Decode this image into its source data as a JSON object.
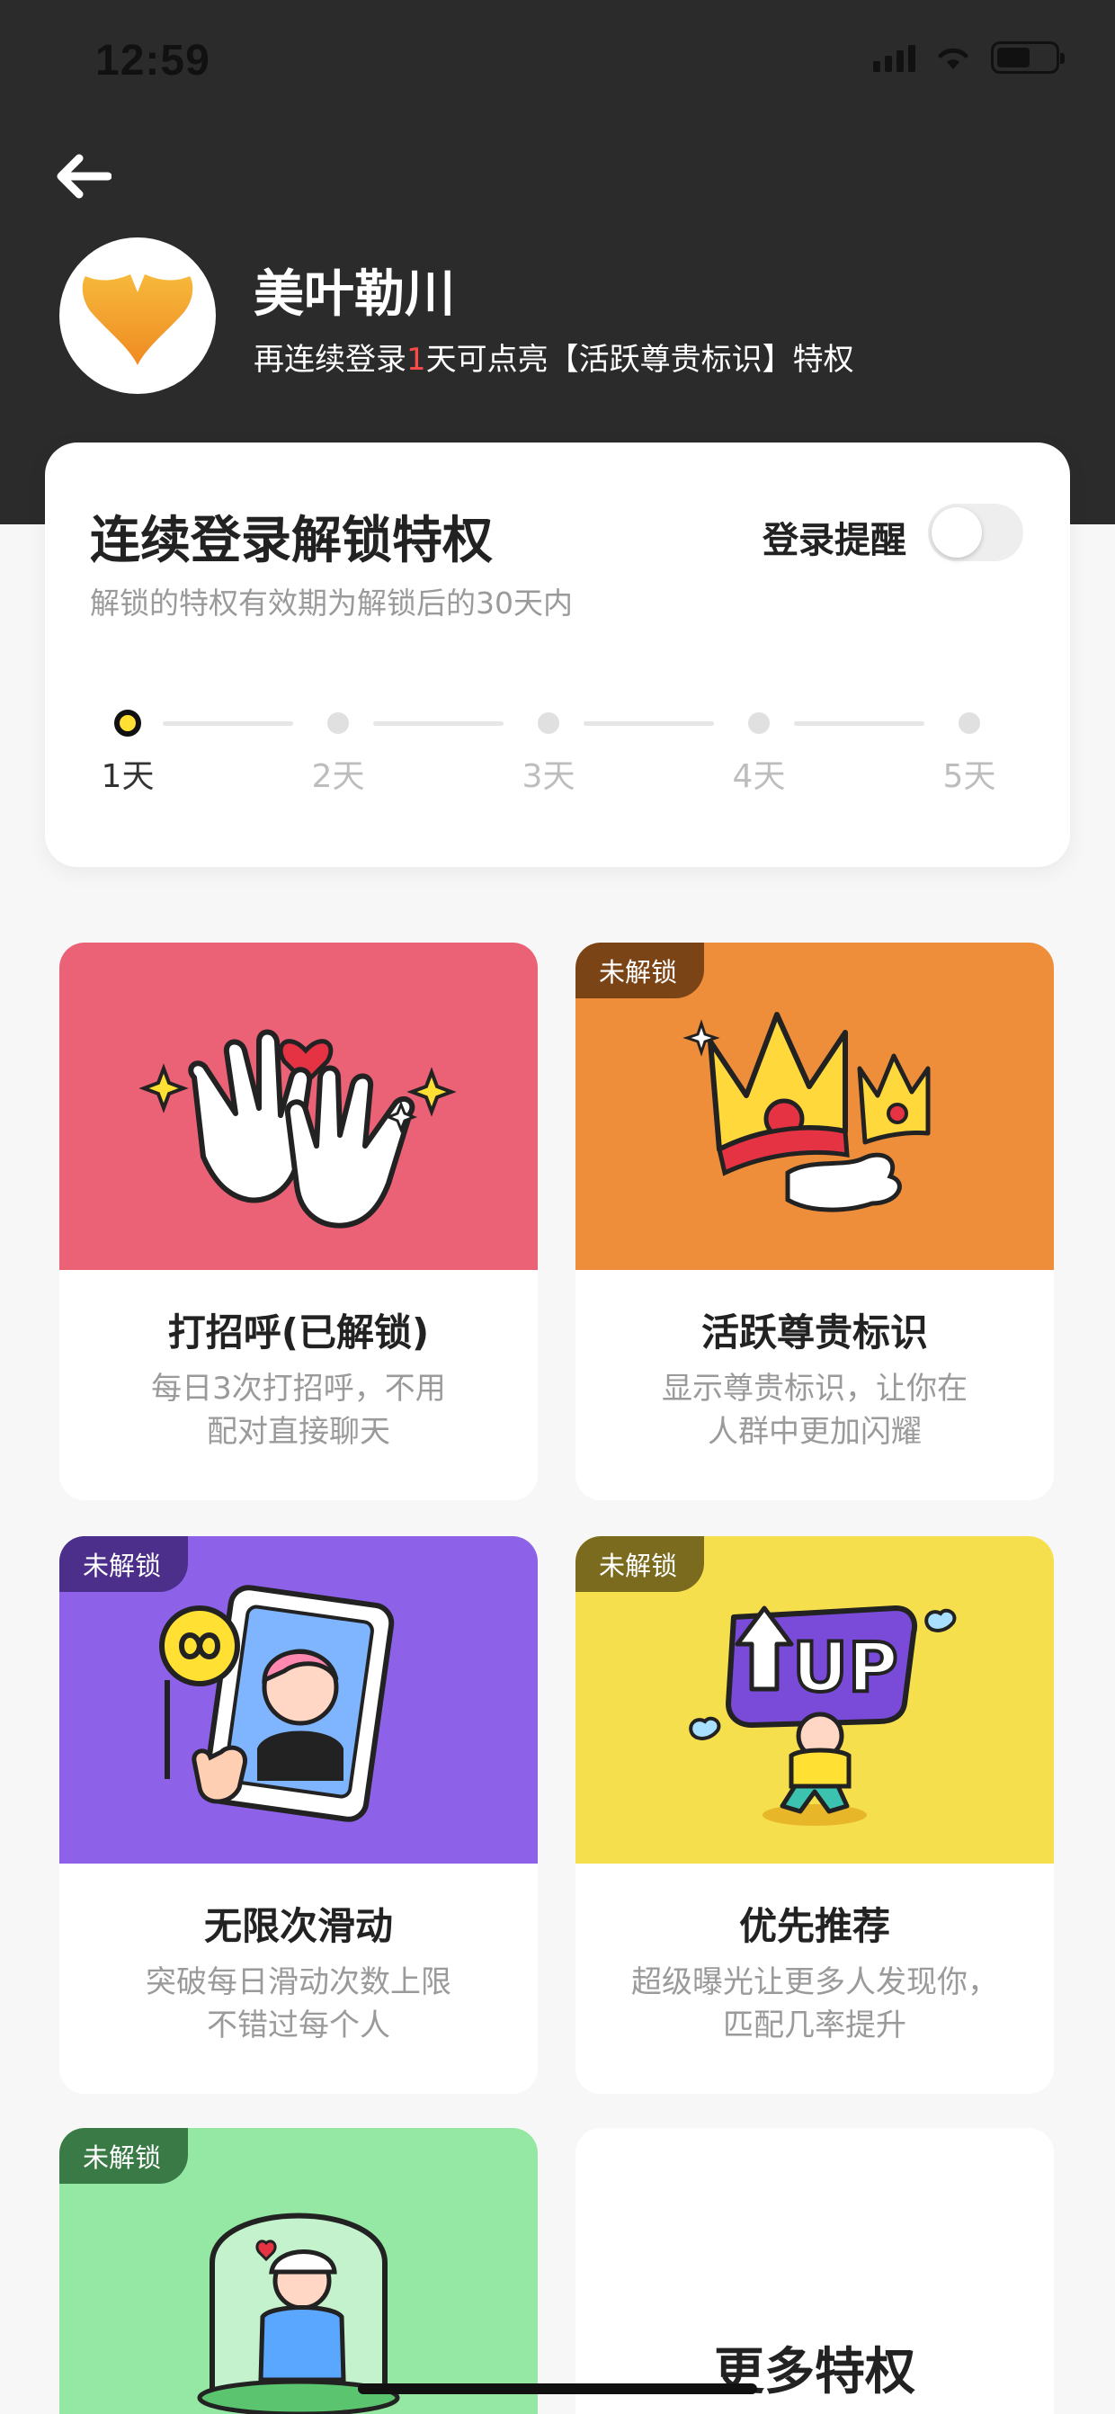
{
  "status_bar": {
    "time": "12:59"
  },
  "header": {
    "username": "美叶勒川",
    "subtitle_prefix": "再连续登录",
    "subtitle_count": "1",
    "subtitle_suffix": "天可点亮【活跃尊贵标识】特权"
  },
  "login_card": {
    "title": "连续登录解锁特权",
    "subtitle": "解锁的特权有效期为解锁后的30天内",
    "reminder_label": "登录提醒",
    "reminder_on": false,
    "current_day": 1,
    "days": [
      "1天",
      "2天",
      "3天",
      "4天",
      "5天"
    ]
  },
  "features": [
    {
      "title": "打招呼(已解锁)",
      "desc_line1": "每日3次打招呼，不用",
      "desc_line2": "配对直接聊天",
      "color": "#eb6276",
      "locked": false
    },
    {
      "title": "活跃尊贵标识",
      "desc_line1": "显示尊贵标识，让你在",
      "desc_line2": "人群中更加闪耀",
      "color": "#ef8e3a",
      "locked": true,
      "badge": "未解锁"
    },
    {
      "title": "无限次滑动",
      "desc_line1": "突破每日滑动次数上限",
      "desc_line2": "不错过每个人",
      "color": "#8e62e8",
      "locked": true,
      "badge": "未解锁"
    },
    {
      "title": "优先推荐",
      "desc_line1": "超级曝光让更多人发现你，",
      "desc_line2": "匹配几率提升",
      "color": "#f6df4c",
      "locked": true,
      "badge": "未解锁"
    },
    {
      "title": "",
      "color": "#94e8a4",
      "locked": true,
      "badge": "未解锁"
    }
  ],
  "more": {
    "title": "更多特权"
  },
  "icons": [
    "back-arrow-icon",
    "ginkgo-leaf-icon",
    "signal-icon",
    "wifi-icon",
    "battery-icon"
  ]
}
